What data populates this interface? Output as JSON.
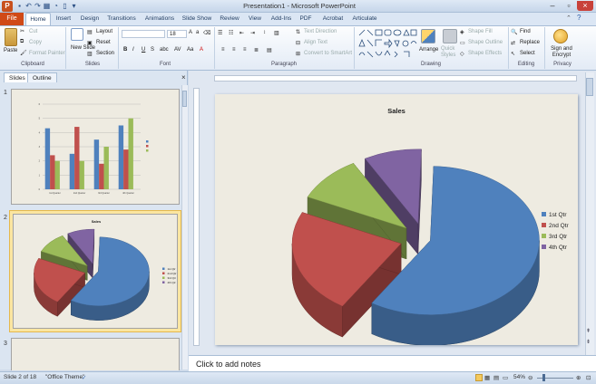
{
  "window": {
    "title": "Presentation1 - Microsoft PowerPoint",
    "app_icon": "P"
  },
  "tabs": [
    "File",
    "Home",
    "Insert",
    "Design",
    "Transitions",
    "Animations",
    "Slide Show",
    "Review",
    "View",
    "Add-Ins",
    "PDF",
    "Acrobat",
    "Articulate"
  ],
  "ribbon": {
    "clipboard": {
      "paste": "Paste",
      "cut": "Cut",
      "copy": "Copy",
      "format_painter": "Format Painter",
      "label": "Clipboard"
    },
    "slides": {
      "new_slide": "New Slide",
      "layout": "Layout",
      "reset": "Reset",
      "section": "Section",
      "label": "Slides"
    },
    "font": {
      "size": "18",
      "label": "Font"
    },
    "paragraph": {
      "text_direction": "Text Direction",
      "align_text": "Align Text",
      "convert_smartart": "Convert to SmartArt",
      "label": "Paragraph"
    },
    "drawing": {
      "arrange": "Arrange",
      "quick_styles": "Quick Styles",
      "shape_fill": "Shape Fill",
      "shape_outline": "Shape Outline",
      "shape_effects": "Shape Effects",
      "label": "Drawing"
    },
    "editing": {
      "find": "Find",
      "replace": "Replace",
      "select": "Select",
      "label": "Editing"
    },
    "privacy": {
      "sign_encrypt": "Sign and Encrypt",
      "label": "Privacy"
    }
  },
  "pane": {
    "tab_slides": "Slides",
    "tab_outline": "Outline",
    "close": "×",
    "slide_numbers": [
      "1",
      "2",
      "3"
    ]
  },
  "notes_placeholder": "Click to add notes",
  "status": {
    "slide_info": "Slide 2 of 18",
    "theme": "\"Office Theme\"",
    "zoom": "54%"
  },
  "colors": {
    "blue": "#4f81bd",
    "red": "#c0504d",
    "green": "#9bbb59",
    "purple": "#8064a2",
    "file_tab": "#d04a17"
  },
  "chart_data": [
    {
      "type": "pie",
      "title": "Sales",
      "categories": [
        "1st Qtr",
        "2nd Qtr",
        "3rd Qtr",
        "4th Qtr"
      ],
      "values": [
        8.2,
        3.2,
        1.4,
        1.2
      ],
      "style": "3d-exploded",
      "legend": "right"
    },
    {
      "type": "bar",
      "title": "",
      "categories": [
        "1st Quarter",
        "2nd Quarter",
        "3rd Quarter",
        "4th Quarter"
      ],
      "series": [
        {
          "name": "",
          "values": [
            4.3,
            2.5,
            3.5,
            4.5
          ],
          "color": "#4f81bd"
        },
        {
          "name": "",
          "values": [
            2.4,
            4.4,
            1.8,
            2.8
          ],
          "color": "#c0504d"
        },
        {
          "name": "",
          "values": [
            2.0,
            2.0,
            3.0,
            5.0
          ],
          "color": "#9bbb59"
        }
      ],
      "ylim": [
        0,
        6
      ],
      "grid": true,
      "legend": "right"
    }
  ]
}
